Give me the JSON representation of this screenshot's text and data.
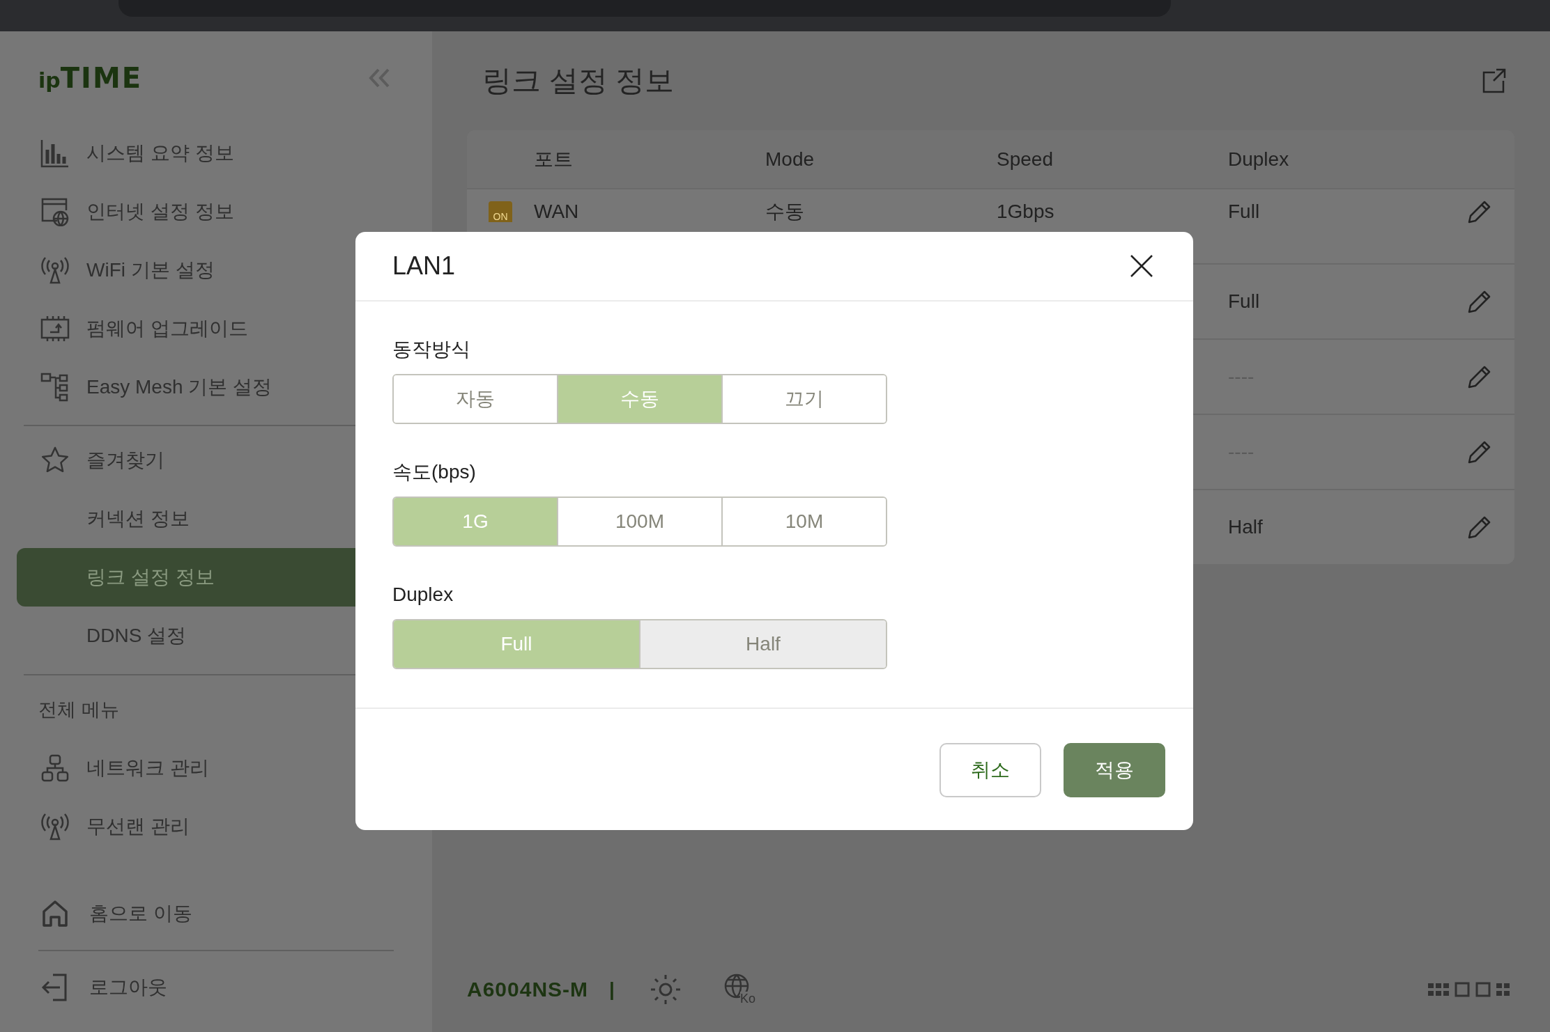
{
  "sidebar": {
    "logo": {
      "prefix": "ip",
      "name": "TIME"
    },
    "quick_items": [
      {
        "label": "시스템 요약 정보"
      },
      {
        "label": "인터넷 설정 정보"
      },
      {
        "label": "WiFi 기본 설정"
      },
      {
        "label": "펌웨어 업그레이드"
      },
      {
        "label": "Easy Mesh 기본 설정"
      }
    ],
    "favorites": {
      "label": "즐겨찾기",
      "items": [
        {
          "label": "커넥션 정보",
          "selected": false
        },
        {
          "label": "링크 설정 정보",
          "selected": true
        },
        {
          "label": "DDNS 설정",
          "selected": false
        }
      ]
    },
    "all_menu": {
      "heading": "전체 메뉴",
      "items": [
        {
          "label": "네트워크 관리"
        },
        {
          "label": "무선랜 관리"
        }
      ]
    },
    "bottom_items": [
      {
        "label": "홈으로 이동"
      },
      {
        "label": "로그아웃"
      }
    ]
  },
  "main": {
    "title": "링크 설정 정보",
    "table": {
      "columns": [
        "포트",
        "Mode",
        "Speed",
        "Duplex"
      ],
      "rows": [
        {
          "port": "WAN",
          "badge": "ON",
          "mode": "수동",
          "speed": "1Gbps",
          "duplex": "Full",
          "muted": false
        },
        {
          "duplex": "Full",
          "muted": false
        },
        {
          "duplex": "----",
          "muted": true
        },
        {
          "duplex": "----",
          "muted": true
        },
        {
          "duplex": "Half",
          "muted": false
        }
      ]
    }
  },
  "footer": {
    "model": "A6004NS-M",
    "separator": "|",
    "language": "Ko"
  },
  "dialog": {
    "title": "LAN1",
    "groups": [
      {
        "label": "동작방식",
        "options": [
          {
            "label": "자동",
            "selected": false,
            "disabled": false
          },
          {
            "label": "수동",
            "selected": true,
            "disabled": false
          },
          {
            "label": "끄기",
            "selected": false,
            "disabled": false
          }
        ]
      },
      {
        "label": "속도(bps)",
        "options": [
          {
            "label": "1G",
            "selected": true,
            "disabled": false
          },
          {
            "label": "100M",
            "selected": false,
            "disabled": false
          },
          {
            "label": "10M",
            "selected": false,
            "disabled": false
          }
        ]
      },
      {
        "label": "Duplex",
        "options": [
          {
            "label": "Full",
            "selected": true,
            "disabled": false
          },
          {
            "label": "Half",
            "selected": false,
            "disabled": true
          }
        ]
      }
    ],
    "buttons": [
      {
        "label": "취소",
        "kind": "secondary"
      },
      {
        "label": "적용",
        "kind": "primary"
      }
    ]
  }
}
